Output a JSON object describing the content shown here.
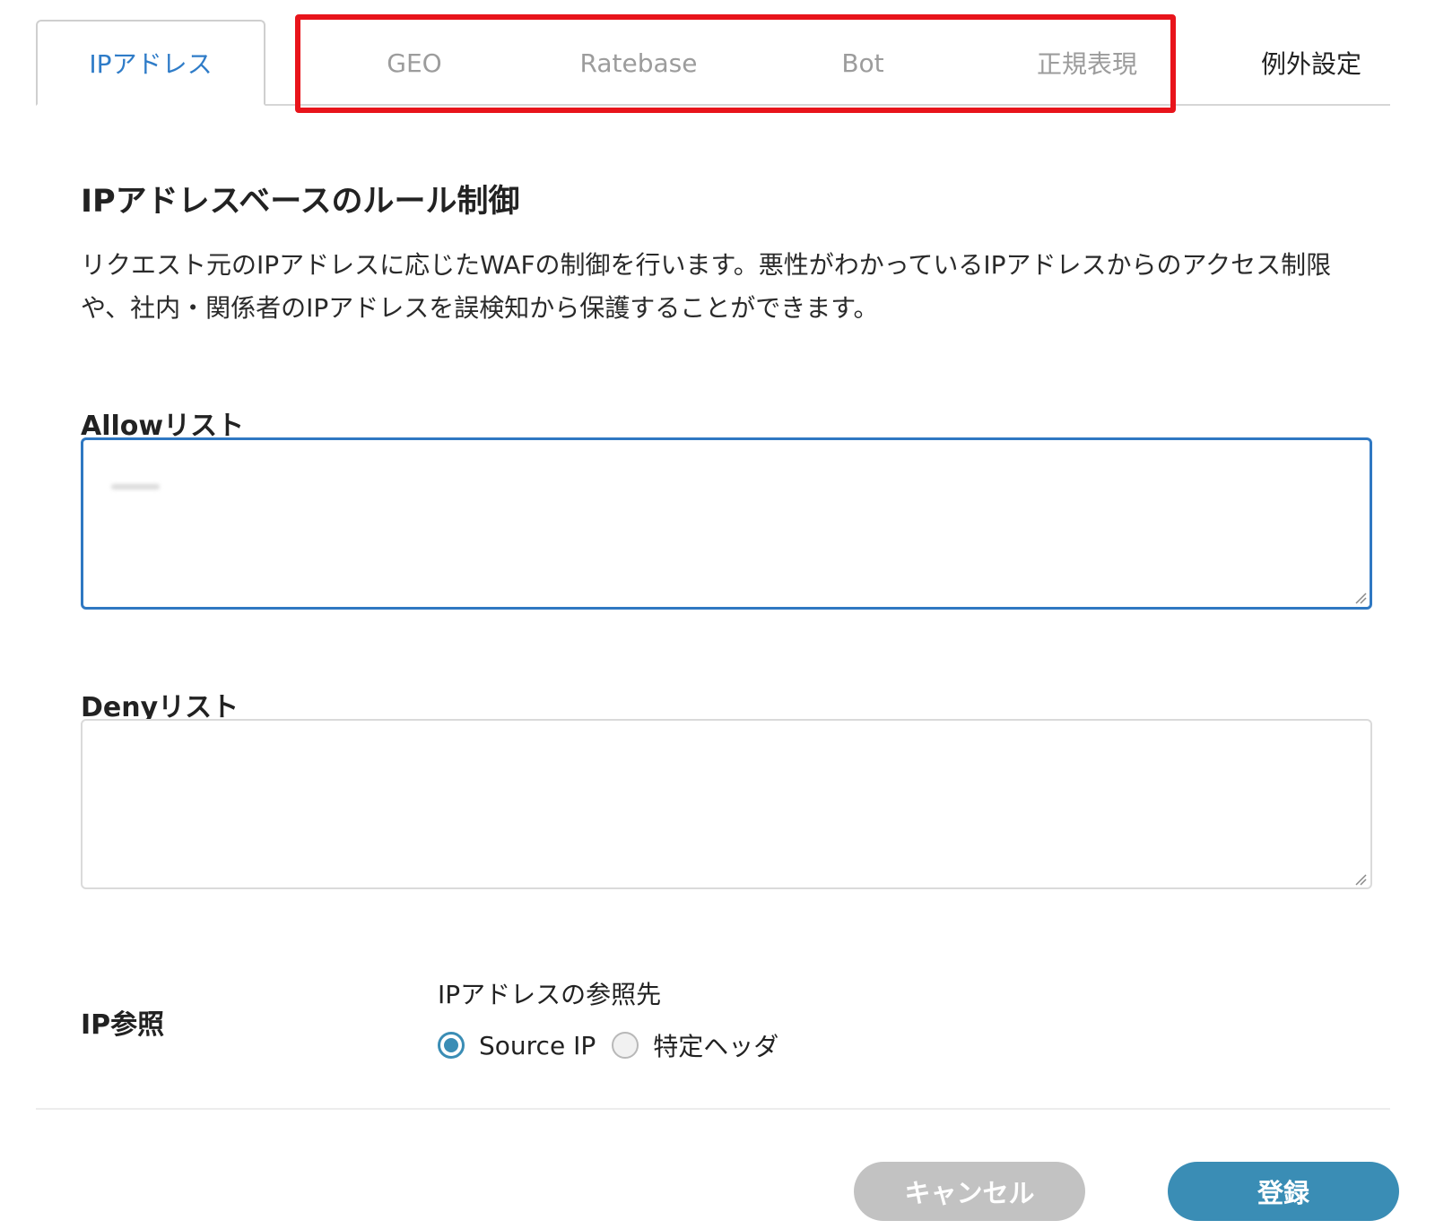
{
  "tabs": [
    {
      "label": "IPアドレス",
      "state": "active"
    },
    {
      "label": "GEO",
      "state": "disabled"
    },
    {
      "label": "Ratebase",
      "state": "disabled"
    },
    {
      "label": "Bot",
      "state": "disabled"
    },
    {
      "label": "正規表現",
      "state": "disabled"
    },
    {
      "label": "例外設定",
      "state": "normal"
    }
  ],
  "section": {
    "title": "IPアドレスベースのルール制御",
    "description": "リクエスト元のIPアドレスに応じたWAFの制御を行います。悪性がわかっているIPアドレスからのアクセス制限や、社内・関係者のIPアドレスを誤検知から保護することができます。"
  },
  "allow_list": {
    "label": "Allowリスト",
    "value": ""
  },
  "deny_list": {
    "label": "Denyリスト",
    "value": ""
  },
  "ip_reference": {
    "label": "IP参照",
    "sublabel": "IPアドレスの参照先",
    "options": [
      {
        "label": "Source IP",
        "checked": true
      },
      {
        "label": "特定ヘッダ",
        "checked": false
      }
    ]
  },
  "buttons": {
    "cancel": "キャンセル",
    "submit": "登録"
  },
  "colors": {
    "accent": "#3a8db5",
    "active_tab_text": "#2f7cc8",
    "focus_border": "#2f78c2",
    "highlight": "#e8141b",
    "cancel_button": "#c2c2c2"
  }
}
